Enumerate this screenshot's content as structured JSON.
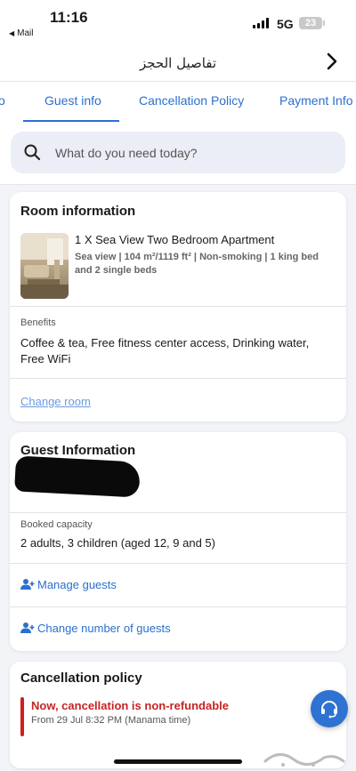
{
  "status_bar": {
    "time": "11:16",
    "back_app": "Mail",
    "network": "5G",
    "battery": "23"
  },
  "header": {
    "title": "تفاصيل الحجز"
  },
  "tabs": [
    {
      "label": "o"
    },
    {
      "label": "Guest info",
      "active": true
    },
    {
      "label": "Cancellation Policy"
    },
    {
      "label": "Payment Info"
    }
  ],
  "search": {
    "placeholder": "What do you need today?"
  },
  "room_info": {
    "title": "Room information",
    "room_name": "1 X Sea View Two Bedroom Apartment",
    "room_details": "Sea view | 104 m²/1119 ft² | Non-smoking | 1 king bed and 2 single beds",
    "benefits_label": "Benefits",
    "benefits": "Coffee & tea, Free fitness center access, Drinking water, Free WiFi",
    "change_room": "Change room"
  },
  "guest_info": {
    "title": "Guest Information",
    "booked_capacity_label": "Booked capacity",
    "booked_capacity": "2 adults, 3 children (aged 12, 9 and 5)",
    "manage_guests": "Manage guests",
    "change_number": "Change number of guests"
  },
  "cancellation": {
    "title": "Cancellation policy",
    "status": "Now, cancellation is non-refundable",
    "date": "From 29 Jul 8:32 PM (Manama time)"
  },
  "icons": {
    "search": "search-icon",
    "back": "chevron-right-icon",
    "help": "headset-icon",
    "person": "person-icon"
  },
  "colors": {
    "accent": "#2b6fcf",
    "danger": "#c62323",
    "fab": "#2e72d2"
  }
}
